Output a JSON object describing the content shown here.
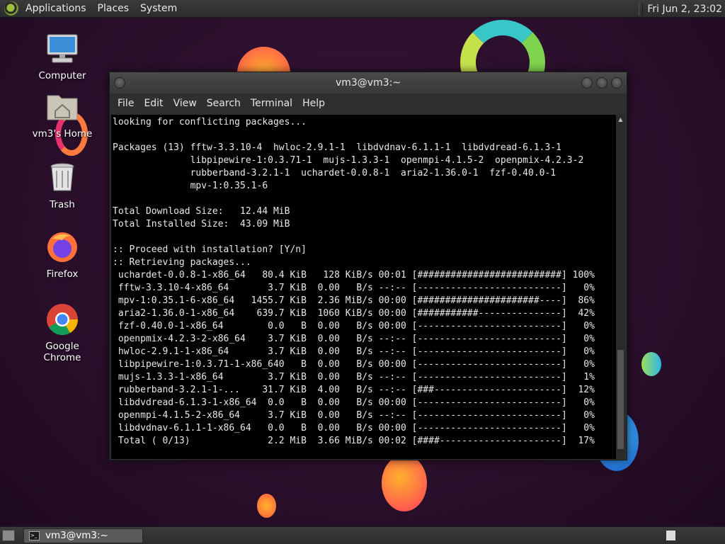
{
  "top_panel": {
    "menus": [
      "Applications",
      "Places",
      "System"
    ],
    "clock": "Fri Jun  2, 23:02"
  },
  "desktop_icons": [
    {
      "label": "Computer",
      "icon": "computer-icon"
    },
    {
      "label": "vm3's Home",
      "icon": "home-folder-icon"
    },
    {
      "label": "Trash",
      "icon": "trash-icon"
    },
    {
      "label": "Firefox",
      "icon": "firefox-icon"
    },
    {
      "label": "Google Chrome",
      "icon": "chrome-icon"
    }
  ],
  "window": {
    "title": "vm3@vm3:~",
    "menus": [
      "File",
      "Edit",
      "View",
      "Search",
      "Terminal",
      "Help"
    ]
  },
  "terminal": {
    "lines": [
      "looking for conflicting packages...",
      "",
      "Packages (13) fftw-3.3.10-4  hwloc-2.9.1-1  libdvdnav-6.1.1-1  libdvdread-6.1.3-1",
      "              libpipewire-1:0.3.71-1  mujs-1.3.3-1  openmpi-4.1.5-2  openpmix-4.2.3-2",
      "              rubberband-3.2.1-1  uchardet-0.0.8-1  aria2-1.36.0-1  fzf-0.40.0-1",
      "              mpv-1:0.35.1-6",
      "",
      "Total Download Size:   12.44 MiB",
      "Total Installed Size:  43.09 MiB",
      "",
      ":: Proceed with installation? [Y/n]",
      ":: Retrieving packages...",
      " uchardet-0.0.8-1-x86_64   80.4 KiB   128 KiB/s 00:01 [##########################] 100%",
      " fftw-3.3.10-4-x86_64       3.7 KiB  0.00   B/s --:-- [--------------------------]   0%",
      " mpv-1:0.35.1-6-x86_64   1455.7 KiB  2.36 MiB/s 00:00 [######################----]  86%",
      " aria2-1.36.0-1-x86_64    639.7 KiB  1060 KiB/s 00:00 [###########---------------]  42%",
      " fzf-0.40.0-1-x86_64        0.0   B  0.00   B/s 00:00 [--------------------------]   0%",
      " openpmix-4.2.3-2-x86_64    3.7 KiB  0.00   B/s --:-- [--------------------------]   0%",
      " hwloc-2.9.1-1-x86_64       3.7 KiB  0.00   B/s --:-- [--------------------------]   0%",
      " libpipewire-1:0.3.71-1-x86_640   B  0.00   B/s 00:00 [--------------------------]   0%",
      " mujs-1.3.3-1-x86_64        3.7 KiB  0.00   B/s --:-- [--------------------------]   1%",
      " rubberband-3.2.1-1-...    31.7 KiB  4.00   B/s --:-- [###-----------------------]  12%",
      " libdvdread-6.1.3-1-x86_64  0.0   B  0.00   B/s 00:00 [--------------------------]   0%",
      " openmpi-4.1.5-2-x86_64     3.7 KiB  0.00   B/s --:-- [--------------------------]   0%",
      " libdvdnav-6.1.1-1-x86_64   0.0   B  0.00   B/s 00:00 [--------------------------]   0%",
      " Total ( 0/13)              2.2 MiB  3.66 MiB/s 00:02 [####----------------------]  17%"
    ]
  },
  "taskbar": {
    "task_label": "vm3@vm3:~"
  }
}
